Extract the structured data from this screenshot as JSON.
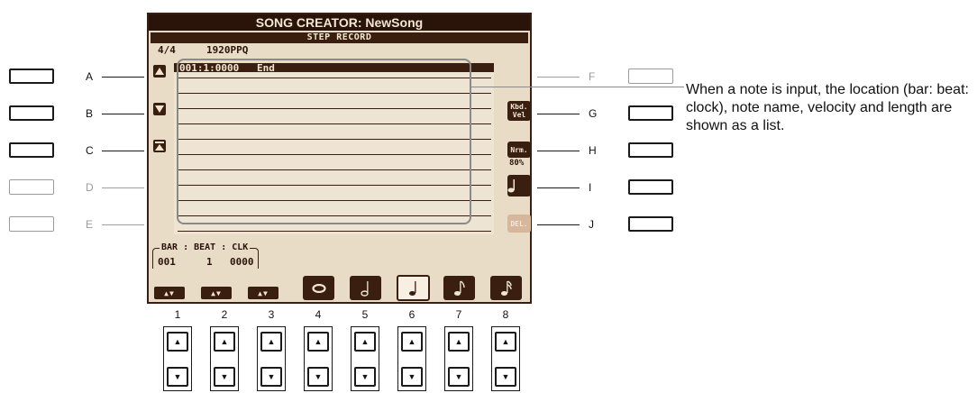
{
  "lcd": {
    "title": "SONG CREATOR: NewSong",
    "subtitle": "STEP RECORD",
    "time_signature": "4/4",
    "resolution": "1920PPQ",
    "first_entry": {
      "position": "001:1:0000",
      "event": "End"
    },
    "position_header": "BAR : BEAT : CLK",
    "bar_value": "001",
    "beat_value": "1",
    "clock_value": "0000",
    "kbd_vel_top": "Kbd.",
    "kbd_vel_bottom": "Vel",
    "nrm_label": "Nrm.",
    "nrm_value": "80%",
    "del_label": "DEL."
  },
  "left_labels": [
    "A",
    "B",
    "C",
    "D",
    "E"
  ],
  "right_labels": [
    "F",
    "G",
    "H",
    "I",
    "J"
  ],
  "column_numbers": [
    "1",
    "2",
    "3",
    "4",
    "5",
    "6",
    "7",
    "8"
  ],
  "caption": "When a note is input, the location (bar: beat: clock), note name, velocity and length are shown as a list.",
  "icons": {
    "up": "triangle-up-icon",
    "down": "triangle-down-icon",
    "top": "jump-to-top-icon",
    "notes": [
      "whole-note-icon",
      "half-note-icon",
      "quarter-note-icon",
      "eighth-note-icon",
      "sixteenth-note-icon"
    ]
  },
  "colors": {
    "lcd_bg": "#e9dcc6",
    "lcd_dark": "#3a1f10"
  }
}
